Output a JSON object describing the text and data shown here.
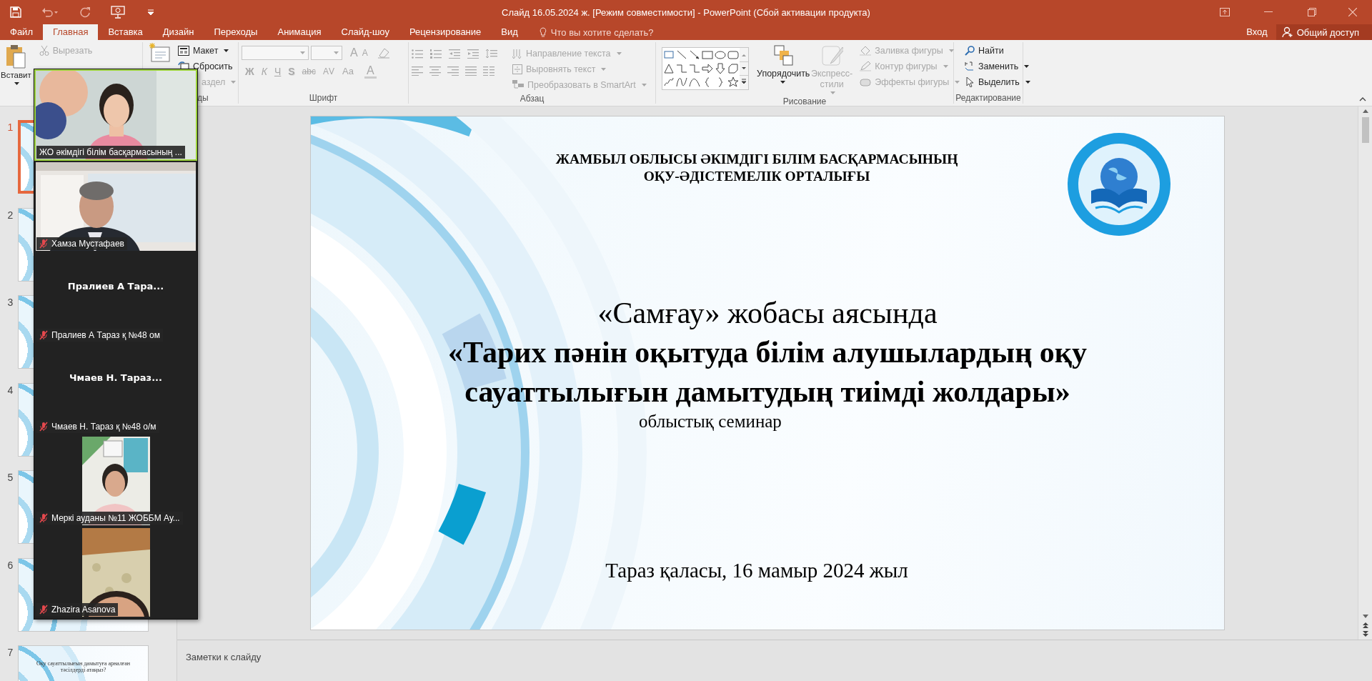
{
  "window": {
    "title": "Слайд  16.05.2024 ж. [Режим совместимости] - PowerPoint (Сбой активации продукта)"
  },
  "tabs": [
    {
      "label": "Файл",
      "selected": false
    },
    {
      "label": "Главная",
      "selected": true
    },
    {
      "label": "Вставка",
      "selected": false
    },
    {
      "label": "Дизайн",
      "selected": false
    },
    {
      "label": "Переходы",
      "selected": false
    },
    {
      "label": "Анимация",
      "selected": false
    },
    {
      "label": "Слайд-шоу",
      "selected": false
    },
    {
      "label": "Рецензирование",
      "selected": false
    },
    {
      "label": "Вид",
      "selected": false
    }
  ],
  "tell_me": {
    "placeholder": "Что вы хотите сделать?"
  },
  "account": {
    "sign_in": "Вход",
    "share": "Общий доступ"
  },
  "ribbon": [
    {
      "kind": "clipboard",
      "items": [
        {
          "label": "Вставит",
          "kind": "large",
          "dropdown": true,
          "disabled": false
        },
        {
          "label": "Вырезать",
          "kind": "small",
          "dropdown": false,
          "disabled": true
        }
      ]
    },
    {
      "kind": "slides",
      "label": "ды",
      "items": [
        {
          "label": "Макет",
          "kind": "small",
          "dropdown": true,
          "disabled": false
        },
        {
          "label": "Сбросить",
          "kind": "small",
          "dropdown": false,
          "disabled": false
        },
        {
          "label": "аздел",
          "kind": "small",
          "dropdown": true,
          "disabled": true
        }
      ]
    },
    {
      "kind": "font",
      "label": "Шрифт",
      "items": [
        {
          "label": "A",
          "kind": "grow",
          "disabled": true
        },
        {
          "label": "A",
          "kind": "shrink",
          "disabled": true
        },
        {
          "label": "Ж",
          "kind": "bold",
          "disabled": true
        },
        {
          "label": "К",
          "kind": "italic",
          "disabled": true
        },
        {
          "label": "Ч",
          "kind": "underline",
          "disabled": true
        },
        {
          "label": "S",
          "kind": "shadow",
          "disabled": true
        },
        {
          "label": "abc",
          "kind": "strike",
          "disabled": true
        },
        {
          "label": "AV",
          "kind": "spacing",
          "disabled": true
        },
        {
          "label": "Aa",
          "kind": "case",
          "disabled": true
        },
        {
          "label": "A",
          "kind": "color",
          "disabled": true
        }
      ]
    },
    {
      "kind": "paragraph",
      "label": "Абзац",
      "items": [
        {
          "label": "Направление текста",
          "kind": "small",
          "dropdown": true,
          "disabled": true
        },
        {
          "label": "Выровнять текст",
          "kind": "small",
          "dropdown": true,
          "disabled": true
        },
        {
          "label": "Преобразовать в SmartArt",
          "kind": "small",
          "dropdown": true,
          "disabled": true
        }
      ]
    },
    {
      "kind": "drawing",
      "label": "Рисование",
      "items": [
        {
          "label": "Упорядочить",
          "kind": "large",
          "dropdown": true,
          "disabled": false
        },
        {
          "label": "Экспресс-стили",
          "kind": "large",
          "dropdown": true,
          "disabled": true
        },
        {
          "label": "Заливка фигуры",
          "kind": "small",
          "dropdown": true,
          "disabled": true
        },
        {
          "label": "Контур фигуры",
          "kind": "small",
          "dropdown": true,
          "disabled": true
        },
        {
          "label": "Эффекты фигуры",
          "kind": "small",
          "dropdown": true,
          "disabled": true
        }
      ]
    },
    {
      "kind": "editing",
      "label": "Редактирование",
      "items": [
        {
          "label": "Найти",
          "kind": "small",
          "dropdown": false,
          "disabled": false
        },
        {
          "label": "Заменить",
          "kind": "small",
          "dropdown": true,
          "disabled": false
        },
        {
          "label": "Выделить",
          "kind": "small",
          "dropdown": true,
          "disabled": false
        }
      ]
    }
  ],
  "thumbnails": [
    {
      "number": "1",
      "selected": true
    },
    {
      "number": "2",
      "selected": false
    },
    {
      "number": "3",
      "selected": false
    },
    {
      "number": "4",
      "selected": false
    },
    {
      "number": "5",
      "selected": false
    },
    {
      "number": "6",
      "selected": false
    },
    {
      "number": "7",
      "selected": false,
      "caption": "Оқу сауаттылығын дамытуға арналған тәсілдерді атаңыз?"
    }
  ],
  "slide": {
    "header": [
      "ЖАМБЫЛ ОБЛЫСЫ ӘКІМДІГІ БІЛІМ БАСҚАРМАСЫНЫҢ",
      "ОҚУ-ӘДІСТЕМЕЛІК ОРТАЛЫҒЫ"
    ],
    "title_lines": [
      {
        "text": "«Самғау» жобасы аясында",
        "bold": false
      },
      {
        "text": "«Тарих пәнін оқытуда білім алушылардың оқу",
        "bold": true
      },
      {
        "text": "сауаттылығын дамытудың тиімді жолдары»",
        "bold": true
      }
    ],
    "event": "облыстық семинар",
    "footer": "Тараз қаласы, 16 мамыр 2024 жыл"
  },
  "notes": {
    "placeholder": "Заметки к слайду"
  },
  "video_panel": {
    "tiles": [
      {
        "kind": "video",
        "name": "ЖО әкімдігі білім басқармасының ...",
        "muted": false,
        "speaking": true
      },
      {
        "kind": "video",
        "name": "Хамза Мустафаев",
        "muted": true,
        "speaking": false
      },
      {
        "kind": "avatar",
        "display_name": "Пралиев  А  Тара...",
        "name": "Пралиев А Тараз қ №48 ом",
        "muted": true,
        "speaking": false
      },
      {
        "kind": "avatar",
        "display_name": "Чмаев  Н.  Тараз...",
        "name": "Чмаев Н. Тараз қ №48 о/м",
        "muted": true,
        "speaking": false
      },
      {
        "kind": "phone",
        "name": "Меркі ауданы  №11 ЖОББМ Ау...",
        "muted": true,
        "speaking": false
      },
      {
        "kind": "phone",
        "name": "Zhazira Asanova",
        "muted": true,
        "speaking": false
      }
    ]
  }
}
